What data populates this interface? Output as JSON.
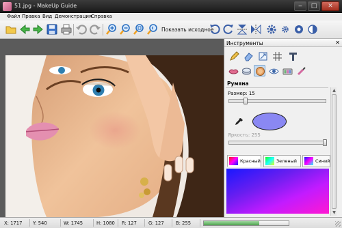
{
  "window": {
    "title": "51.jpg - MakeUp Guide"
  },
  "menu": [
    "Файл",
    "Правка",
    "Вид",
    "Демонстрация",
    "Справка"
  ],
  "toolbar": {
    "show_original_label": "Показать исходное",
    "buttons": [
      "open-folder",
      "back",
      "forward",
      "save",
      "print",
      "undo",
      "redo",
      "zoom-in",
      "zoom-out",
      "zoom-fit",
      "zoom-actual",
      "show-original",
      "rotate-left",
      "rotate-right",
      "flip-vertical",
      "flip-horizontal",
      "settings",
      "settings-small",
      "color-balance",
      "contrast"
    ]
  },
  "tools_panel": {
    "title": "Инструменты",
    "close_glyph": "✕",
    "tools_row1": [
      "pencil",
      "eraser",
      "resize",
      "grid",
      "text"
    ],
    "tools_row2": [
      "lipstick",
      "foundation",
      "blush",
      "eye",
      "eyeshadow",
      "mascara"
    ],
    "selected_tool": "blush",
    "section_title": "Румяна",
    "size_label": "Размер: 15",
    "size_value": 15,
    "brightness_label": "Яркость: 255",
    "brightness_value": 255,
    "brush_color": "#8a88f3",
    "color_tabs": [
      {
        "label": "Красный"
      },
      {
        "label": "Зеленый"
      },
      {
        "label": "Синий"
      }
    ]
  },
  "status": {
    "x": "X: 1717",
    "y": "Y: 540",
    "w": "W: 1745",
    "h": "H: 1080",
    "r": "R: 127",
    "g": "G: 127",
    "b": "B: 255",
    "progress_fraction": 0.65
  }
}
